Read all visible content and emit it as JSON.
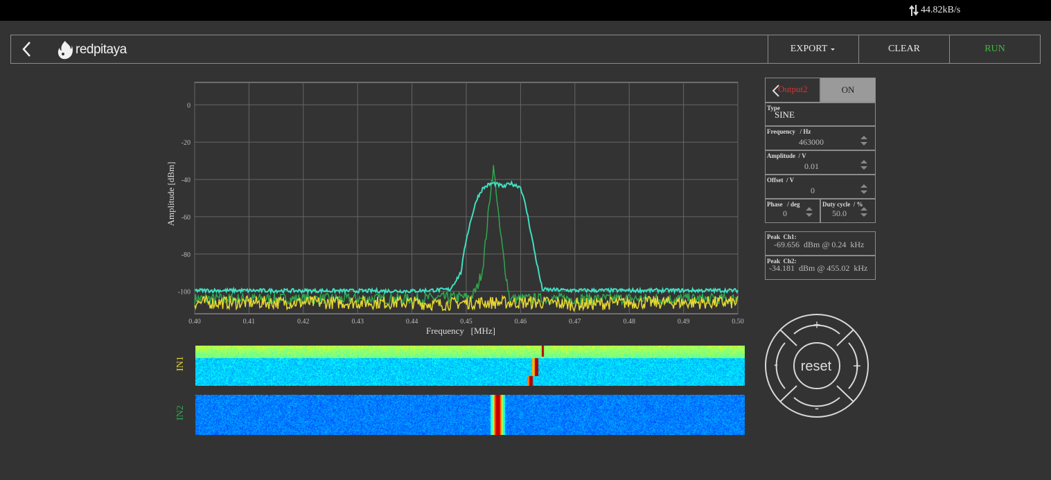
{
  "status_bar": {
    "net_speed": "44.82kB/s"
  },
  "navbar": {
    "logo_text": "redpitaya",
    "export_label": "EXPORT",
    "clear_label": "CLEAR",
    "run_label": "RUN"
  },
  "chart_data": {
    "type": "line",
    "xlabel": "Frequency   [MHz]",
    "ylabel": "Amplitude  [dBm]",
    "xlim": [
      0.4,
      0.5
    ],
    "ylim": [
      -112,
      12
    ],
    "x_ticks": [
      "0.40",
      "0.41",
      "0.42",
      "0.43",
      "0.44",
      "0.45",
      "0.46",
      "0.47",
      "0.48",
      "0.49",
      "0.50"
    ],
    "y_ticks": [
      "0",
      "-20",
      "-40",
      "-60",
      "-80",
      "-100"
    ],
    "grid": true,
    "series": [
      {
        "color": "#40e0c0",
        "x": [
          0.4,
          0.44,
          0.447,
          0.449,
          0.45,
          0.451,
          0.452,
          0.453,
          0.454,
          0.455,
          0.456,
          0.457,
          0.458,
          0.459,
          0.46,
          0.461,
          0.462,
          0.463,
          0.464,
          0.47,
          0.5
        ],
        "y": [
          -99.5,
          -99.8,
          -99,
          -90,
          -72,
          -60,
          -50,
          -45,
          -43,
          -42,
          -43,
          -44,
          -42,
          -43,
          -44,
          -55,
          -70,
          -85,
          -99,
          -99.5,
          -99.5
        ]
      },
      {
        "color": "#e8d830",
        "x": [
          0.4,
          0.42,
          0.44,
          0.445,
          0.45,
          0.455,
          0.46,
          0.465,
          0.47,
          0.48,
          0.49,
          0.5
        ],
        "y": [
          -106,
          -106,
          -106,
          -107,
          -106,
          -106,
          -106,
          -106,
          -107,
          -106,
          -106,
          -106
        ]
      },
      {
        "color": "#2fa84f",
        "x": [
          0.4,
          0.44,
          0.451,
          0.452,
          0.453,
          0.4535,
          0.454,
          0.4545,
          0.455,
          0.4555,
          0.456,
          0.457,
          0.458,
          0.47,
          0.5
        ],
        "y": [
          -104,
          -104,
          -103,
          -98,
          -88,
          -75,
          -60,
          -45,
          -34.2,
          -45,
          -62,
          -85,
          -104,
          -104,
          -104
        ]
      }
    ]
  },
  "waterfall": {
    "in1_label": "IN1",
    "in2_label": "IN2",
    "in1_color": "#e8d830",
    "in2_color": "#2fa84f"
  },
  "generator": {
    "output_label": "Output2",
    "on_label": "ON",
    "type_label": "Type",
    "type_value": "SINE",
    "freq_label": "Frequency   / Hz",
    "freq_value": "463000",
    "amp_label": "Amplitude  / V",
    "amp_value": "0.01",
    "offset_label": "Offset  / V",
    "offset_value": "0",
    "phase_label": "Phase   / deg",
    "phase_value": "0",
    "duty_label": "Duty cycle  / %",
    "duty_value": "50.0"
  },
  "peaks": {
    "ch1_label": "Peak  Ch1:",
    "ch1_value": "-69.656  dBm @ 0.24  kHz",
    "ch2_label": "Peak  Ch2:",
    "ch2_value": "-34.181  dBm @ 455.02  kHz"
  },
  "dpad": {
    "reset_label": "reset",
    "plus": "+",
    "minus": "-"
  }
}
